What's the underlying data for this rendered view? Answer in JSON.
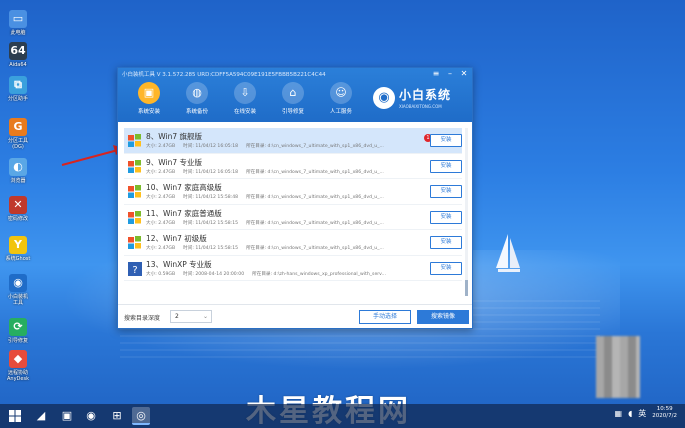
{
  "desktop": {
    "icons": [
      {
        "label": "此电脑",
        "icon": "computer-icon",
        "color": "#4a90e2",
        "glyph": "▭"
      },
      {
        "label": "Aida64",
        "icon": "aida64-icon",
        "color": "#2c3e50",
        "glyph": "64"
      },
      {
        "label": "分区助手",
        "icon": "partition-icon",
        "color": "#3aa0dd",
        "glyph": "⧉"
      },
      {
        "label": "分区工具\n(DG)",
        "icon": "diskgenius-icon",
        "color": "#e87b1e",
        "glyph": "G"
      },
      {
        "label": "浏览器",
        "icon": "browser-icon",
        "color": "#5aa7e6",
        "glyph": "◐"
      },
      {
        "label": "密码修改",
        "icon": "password-icon",
        "color": "#c0392b",
        "glyph": "✕"
      },
      {
        "label": "系统Ghost",
        "icon": "ghost-icon",
        "color": "#f1c40f",
        "glyph": "Y"
      },
      {
        "label": "小白装机\n工具",
        "icon": "xiaobai-icon",
        "color": "#1f6cc8",
        "glyph": "◉"
      },
      {
        "label": "引导修复",
        "icon": "boot-repair-icon",
        "color": "#27ae60",
        "glyph": "⟳"
      },
      {
        "label": "远程协助\nAnyDesk",
        "icon": "anydesk-icon",
        "color": "#e74c3c",
        "glyph": "◆"
      }
    ]
  },
  "window": {
    "title": "小白装机工具 V 3.1.572.285 URD:CDFF5A594C09E191E5FBBB5B221C4C44",
    "controls": {
      "menu": "≡",
      "minimize": "–",
      "close": "✕"
    },
    "nav": [
      {
        "label": "系统安装",
        "icon": "install-icon",
        "glyph": "▣",
        "active": true
      },
      {
        "label": "系统备份",
        "icon": "backup-icon",
        "glyph": "◍",
        "active": false
      },
      {
        "label": "在线安装",
        "icon": "online-icon",
        "glyph": "⇩",
        "active": false
      },
      {
        "label": "引导修复",
        "icon": "repair-icon",
        "glyph": "⌂",
        "active": false
      },
      {
        "label": "人工服务",
        "icon": "service-icon",
        "glyph": "☺",
        "active": false
      }
    ],
    "brand": {
      "name": "小白系统",
      "url": "XIAOBAIXITONG.COM",
      "logo": "◉"
    },
    "list": [
      {
        "name": "8、Win7 旗舰版",
        "size": "大小: 2.47GB",
        "time": "时间: 11/04/12 16:05:18",
        "path": "所在目录: d:\\cn_windows_7_ultimate_with_sp1_x86_dvd_u_...",
        "install": "安装",
        "badge": "1",
        "os": "win7",
        "selected": true
      },
      {
        "name": "9、Win7 专业版",
        "size": "大小: 2.47GB",
        "time": "时间: 11/04/12 16:05:18",
        "path": "所在目录: d:\\cn_windows_7_ultimate_with_sp1_x86_dvd_u_...",
        "install": "安装",
        "os": "win7",
        "selected": false
      },
      {
        "name": "10、Win7 家庭高级版",
        "size": "大小: 2.47GB",
        "time": "时间: 11/04/12 15:58:48",
        "path": "所在目录: d:\\cn_windows_7_ultimate_with_sp1_x86_dvd_u_...",
        "install": "安装",
        "os": "win7",
        "selected": false
      },
      {
        "name": "11、Win7 家庭普通版",
        "size": "大小: 2.47GB",
        "time": "时间: 11/04/12 15:58:15",
        "path": "所在目录: d:\\cn_windows_7_ultimate_with_sp1_x86_dvd_u_...",
        "install": "安装",
        "os": "win7",
        "selected": false
      },
      {
        "name": "12、Win7 初级版",
        "size": "大小: 2.47GB",
        "time": "时间: 11/04/12 15:58:15",
        "path": "所在目录: d:\\cn_windows_7_ultimate_with_sp1_x86_dvd_u_...",
        "install": "安装",
        "os": "win7",
        "selected": false
      },
      {
        "name": "13、WinXP 专业版",
        "size": "大小: 0.59GB",
        "time": "时间: 2008-04-14 20:00:00",
        "path": "所在目录: d:\\zh-hans_windows_xp_professional_with_serv...",
        "install": "安装",
        "os": "winxp",
        "selected": false
      }
    ],
    "footer": {
      "depth_label": "搜索目录深度",
      "depth_value": "2",
      "manual_button": "手动选择",
      "search_button": "搜索镜像"
    }
  },
  "watermark": "木星教程网",
  "taskbar": {
    "time": "10:59",
    "date": "2020/7/2",
    "apps": [
      {
        "icon": "eraser-icon",
        "glyph": "◢"
      },
      {
        "icon": "monitor-icon",
        "glyph": "▣"
      },
      {
        "icon": "network-icon",
        "glyph": "◉"
      },
      {
        "icon": "windows-icon",
        "glyph": "⊞"
      },
      {
        "icon": "xiaobai-taskbar-icon",
        "glyph": "◎",
        "active": true
      }
    ]
  }
}
